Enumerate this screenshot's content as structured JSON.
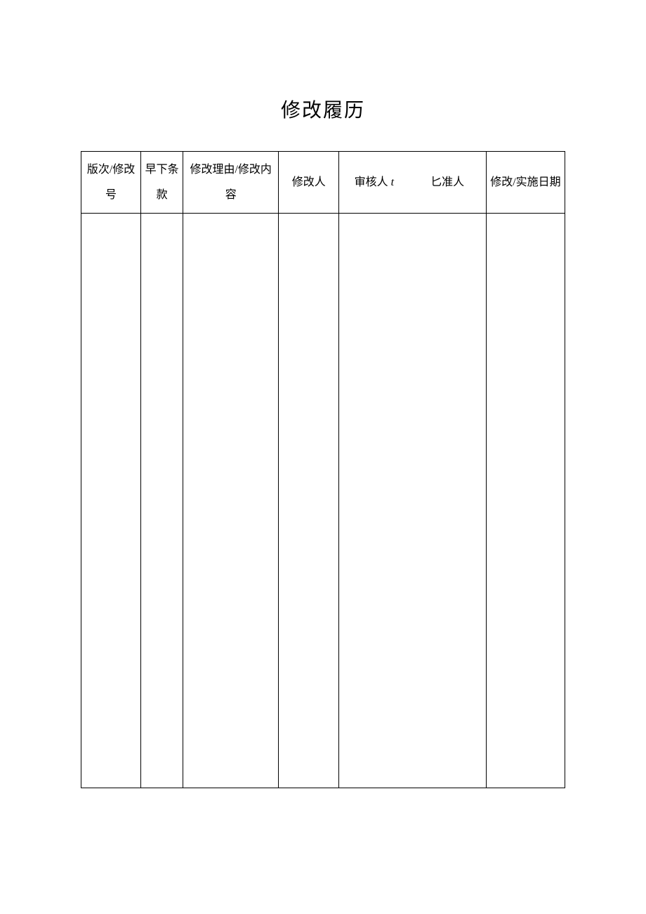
{
  "title": "修改履历",
  "headers": {
    "version": "版次/修改号",
    "clause": "早下条款",
    "reason": "修改理由/修改内容",
    "modifier": "修改人",
    "reviewer_prefix": "审核人 ",
    "reviewer_t": "t",
    "approver": "匕准人",
    "date": "修改/实施日期"
  },
  "rows": [
    {
      "version": "",
      "clause": "",
      "reason": "",
      "modifier": "",
      "reviewer": "",
      "approver": "",
      "date": ""
    }
  ]
}
